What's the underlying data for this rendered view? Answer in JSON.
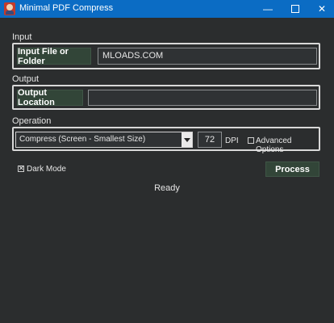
{
  "window": {
    "title": "Minimal PDF Compress",
    "minimize_glyph": "—",
    "close_glyph": "✕"
  },
  "input": {
    "section_label": "Input",
    "button_label": "Input File or Folder",
    "field_value": "MLOADS.COM"
  },
  "output": {
    "section_label": "Output",
    "button_label": "Output Location",
    "field_value": ""
  },
  "operation": {
    "section_label": "Operation",
    "selected": "Compress (Screen - Smallest Size)",
    "dpi_value": "72",
    "dpi_label": "DPI",
    "advanced_label": "Advanced Options",
    "advanced_checked": false
  },
  "options": {
    "dark_mode_label": "Dark Mode",
    "dark_mode_checked": true,
    "dark_mode_glyph": "✕",
    "process_label": "Process"
  },
  "status": "Ready",
  "colors": {
    "titlebar": "#0b6cc4",
    "background": "#2b2d2e",
    "button": "#324538"
  }
}
